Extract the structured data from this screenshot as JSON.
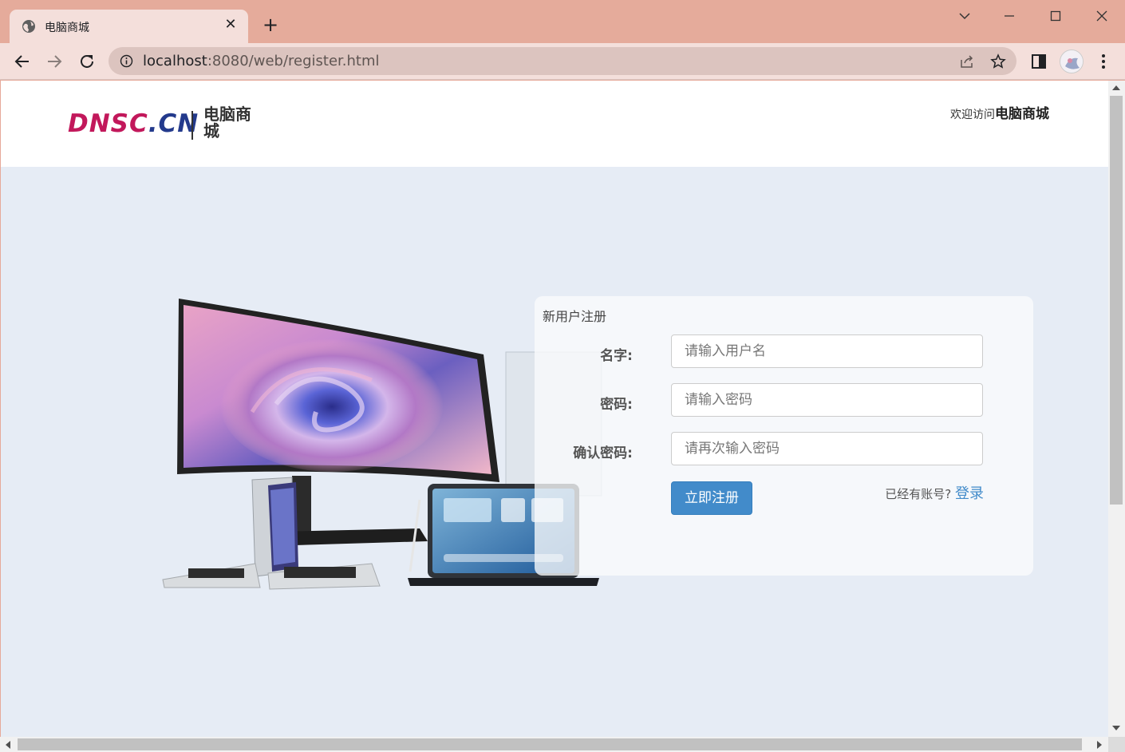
{
  "browser": {
    "tab_title": "电脑商城",
    "url_host": "localhost",
    "url_rest": ":8080/web/register.html"
  },
  "header": {
    "logo_latin_a": "DNSC",
    "logo_latin_b": ".CN",
    "logo_cn": "电脑商城",
    "welcome_prefix": "欢迎访问",
    "welcome_site": "电脑商城"
  },
  "form": {
    "title": "新用户注册",
    "username_label": "名字:",
    "username_placeholder": "请输入用户名",
    "password_label": "密码:",
    "password_placeholder": "请输入密码",
    "confirm_label": "确认密码:",
    "confirm_placeholder": "请再次输入密码",
    "submit_label": "立即注册",
    "have_account_text": "已经有账号?",
    "login_link": "登录"
  },
  "colors": {
    "titlebar": "#e5ab9b",
    "page_bg": "#e6ecf5",
    "accent": "#428bca",
    "logo_magenta": "#c2185b",
    "logo_navy": "#233a8c"
  }
}
